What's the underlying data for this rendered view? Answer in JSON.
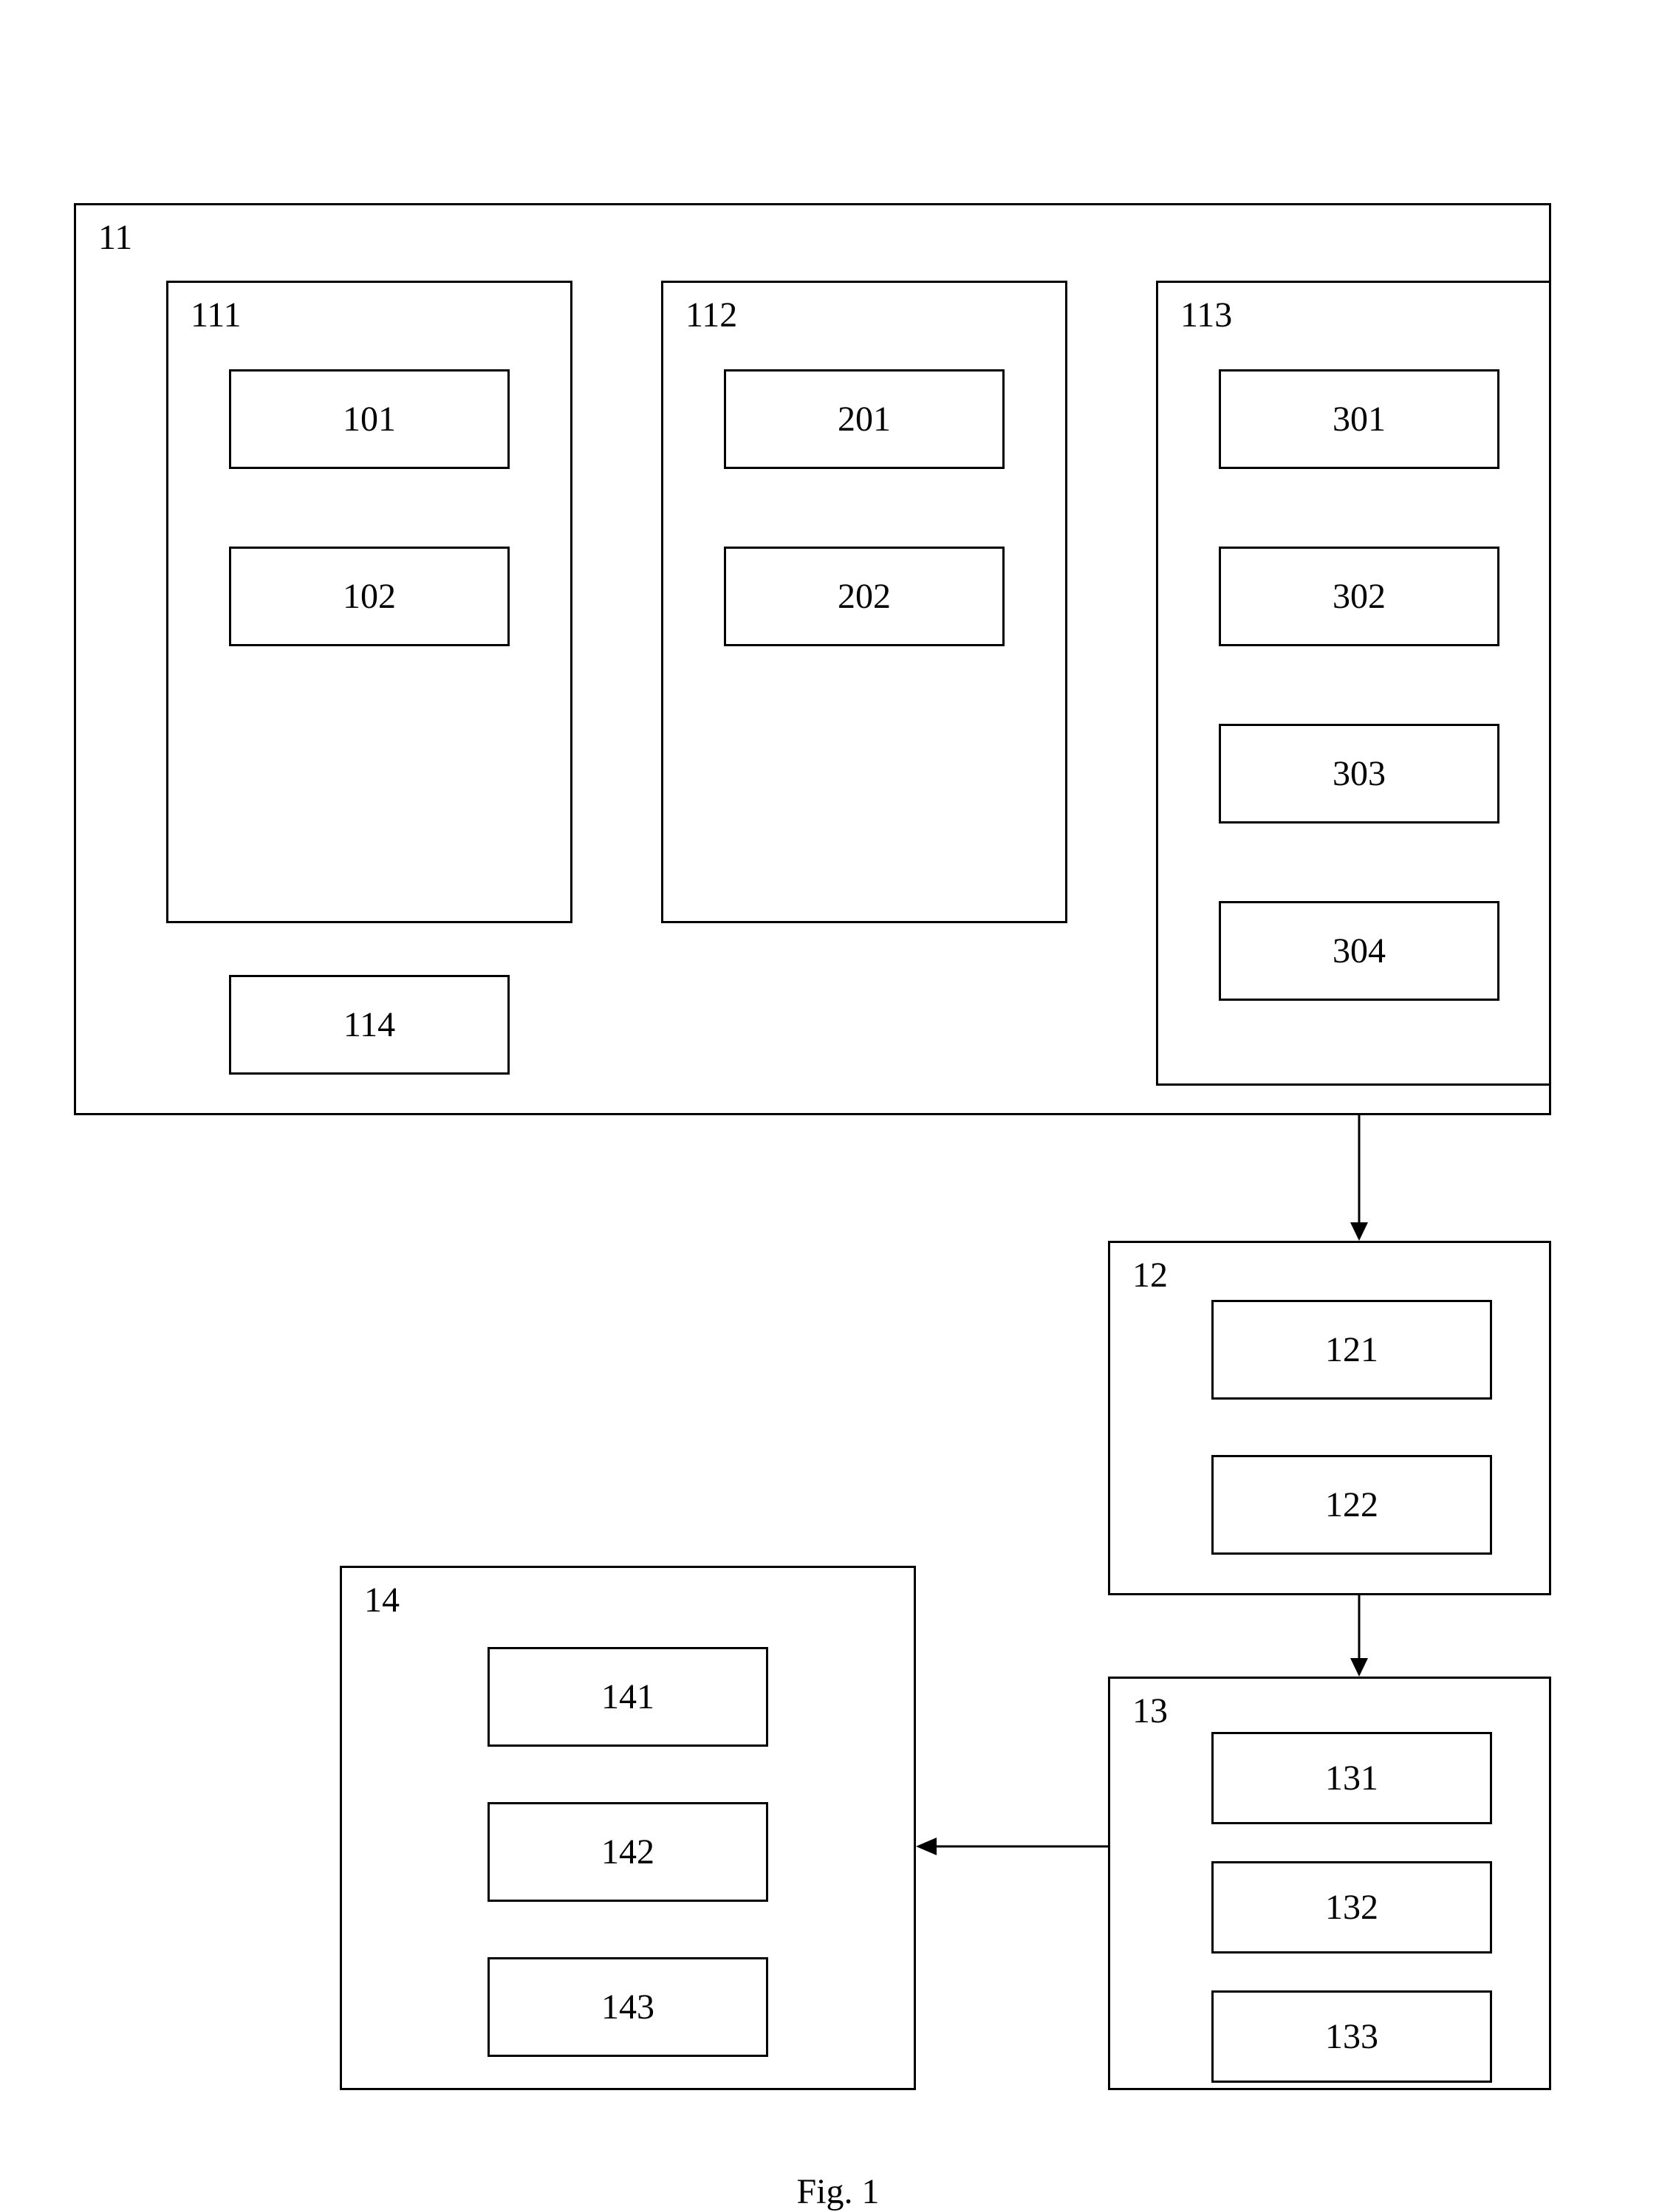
{
  "figure_caption": "Fig. 1",
  "boxes": {
    "outer11": "11",
    "b111": "111",
    "b112": "112",
    "b113": "113",
    "b101": "101",
    "b102": "102",
    "b201": "201",
    "b202": "202",
    "b301": "301",
    "b302": "302",
    "b303": "303",
    "b304": "304",
    "b114": "114",
    "b12": "12",
    "b121": "121",
    "b122": "122",
    "b13": "13",
    "b131": "131",
    "b132": "132",
    "b133": "133",
    "b14": "14",
    "b141": "141",
    "b142": "142",
    "b143": "143"
  }
}
